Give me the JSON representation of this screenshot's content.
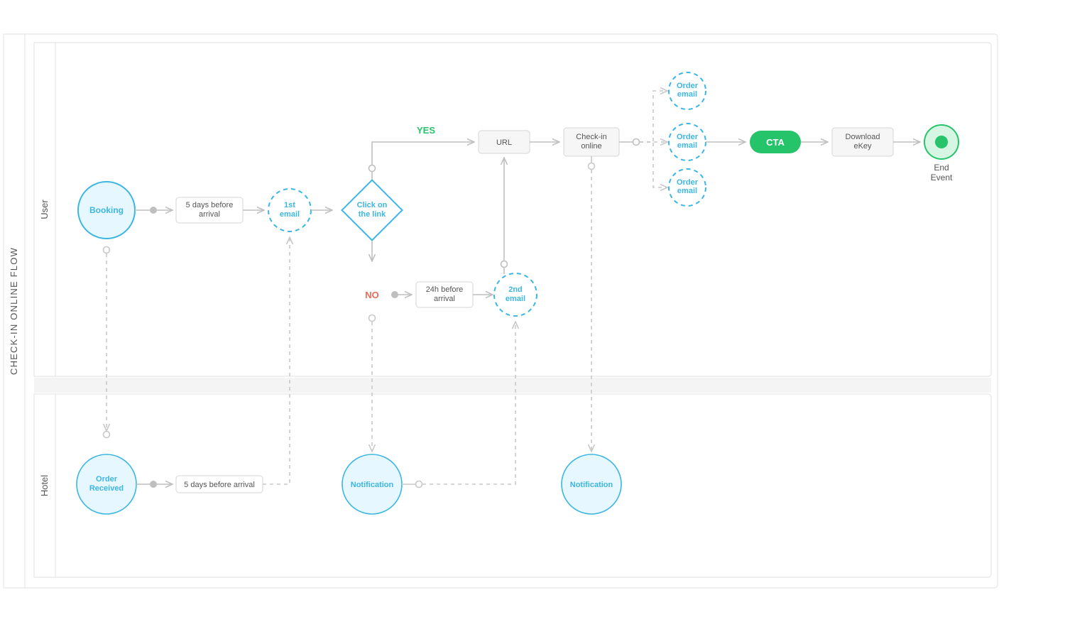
{
  "diagram": {
    "title": "CHECK-IN ONLINE FLOW",
    "lanes": {
      "user": "User",
      "hotel": "Hotel"
    },
    "nodes": {
      "booking": "Booking",
      "wait5": "5 days before\narrival",
      "email1": "1st\nemail",
      "click": "Click on\nthe link",
      "yes": "YES",
      "no": "NO",
      "wait24": "24h before\narrival",
      "email2": "2nd\nemail",
      "url": "URL",
      "checkin": "Check-in\nonline",
      "oe1": "Order\nemail",
      "oe2": "Order\nemail",
      "oe3": "Order\nemail",
      "cta": "CTA",
      "download": "Download\neKey",
      "end": "End\nEvent",
      "orderRecv": "Order\nReceived",
      "wait5b": "5 days before arrival",
      "notif1": "Notification",
      "notif2": "Notification"
    }
  }
}
